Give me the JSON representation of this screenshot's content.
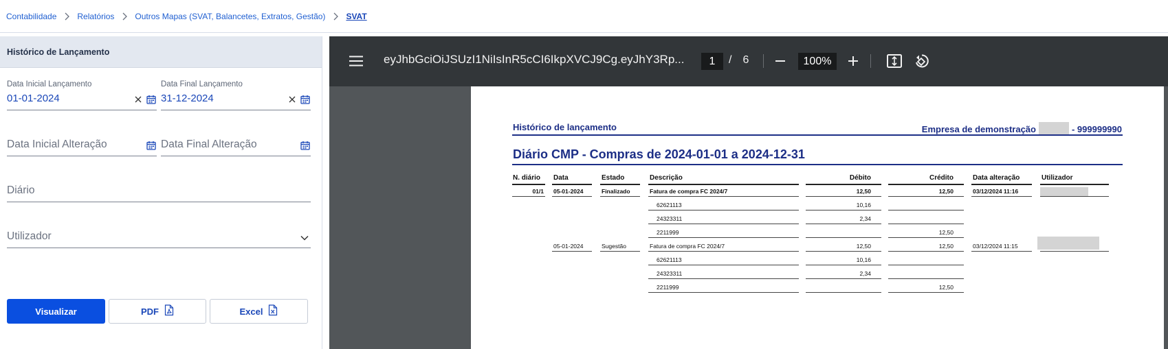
{
  "breadcrumb": [
    "Contabilidade",
    "Relatórios",
    "Outros Mapas (SVAT, Balancetes, Extratos, Gestão)",
    "SVAT"
  ],
  "panel": {
    "title": "Histórico de Lançamento",
    "start_date_label": "Data Inicial Lançamento",
    "start_date_value": "01-01-2024",
    "end_date_label": "Data Final Lançamento",
    "end_date_value": "31-12-2024",
    "start_change_placeholder": "Data Inicial Alteração",
    "end_change_placeholder": "Data Final Alteração",
    "diario_placeholder": "Diário",
    "utilizador_placeholder": "Utilizador",
    "buttons": {
      "view": "Visualizar",
      "pdf": "PDF",
      "excel": "Excel"
    }
  },
  "viewer": {
    "doc_title": "eyJhbGciOiJSUzI1NiIsInR5cCI6IkpXVCJ9Cg.eyJhY3Rp...",
    "page": "1",
    "page_sep": "/",
    "page_total": "6",
    "zoom": "100%"
  },
  "report": {
    "title": "Histórico de lançamento",
    "company": "Empresa de demonstração",
    "company_id": "- 999999990",
    "subtitle": "Diário CMP - Compras de 2024-01-01 a 2024-12-31",
    "columns": [
      "N. diário",
      "Data",
      "Estado",
      "Descrição",
      "Débito",
      "Crédito",
      "Data alteração",
      "Utilizador"
    ],
    "groups": [
      {
        "n_diario": "01/1",
        "data": "05-01-2024",
        "estado": "Finalizado",
        "descricao": "Fatura de compra FC 2024/7",
        "debito": "12,50",
        "credito": "12,50",
        "data_alteracao": "03/12/2024 11:16",
        "lines": [
          {
            "conta": "62621113",
            "debito": "10,16",
            "credito": ""
          },
          {
            "conta": "24323311",
            "debito": "2,34",
            "credito": ""
          },
          {
            "conta": "2211999",
            "debito": "",
            "credito": "12,50"
          }
        ]
      },
      {
        "n_diario": "",
        "data": "05-01-2024",
        "estado": "Sugestão",
        "descricao": "Fatura de compra FC 2024/7",
        "debito": "12,50",
        "credito": "12,50",
        "data_alteracao": "03/12/2024 11:15",
        "lines": [
          {
            "conta": "62621113",
            "debito": "10,16",
            "credito": ""
          },
          {
            "conta": "24323311",
            "debito": "2,34",
            "credito": ""
          },
          {
            "conta": "2211999",
            "debito": "",
            "credito": "12,50"
          }
        ]
      }
    ]
  },
  "colors": {
    "primary": "#0a4fe0",
    "link": "#1f5fd1",
    "report_blue": "#1c2e86",
    "viewer_bg": "#525659",
    "toolbar_bg": "#323639"
  },
  "icons": [
    "chevron-right-icon",
    "clear-icon",
    "calendar-icon",
    "chevron-down-icon",
    "pdf-file-icon",
    "excel-file-icon",
    "menu-icon",
    "zoom-out-icon",
    "zoom-in-icon",
    "fit-page-icon",
    "rotate-icon"
  ]
}
